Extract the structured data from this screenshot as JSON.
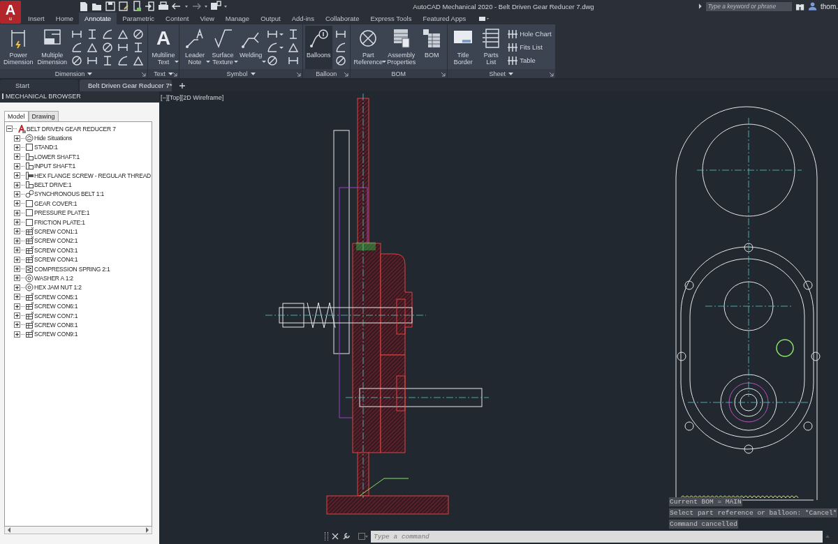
{
  "app_button": {
    "letter": "A",
    "badge": "u"
  },
  "title": "AutoCAD Mechanical 2020 - Belt Driven Gear Reducer 7.dwg",
  "search": {
    "placeholder": "Type a keyword or phrase"
  },
  "user": {
    "name": "thom."
  },
  "ribbon_tabs": [
    {
      "label": "Insert",
      "selected": false
    },
    {
      "label": "Home",
      "selected": false
    },
    {
      "label": "Annotate",
      "selected": true
    },
    {
      "label": "Parametric",
      "selected": false
    },
    {
      "label": "Content",
      "selected": false
    },
    {
      "label": "View",
      "selected": false
    },
    {
      "label": "Manage",
      "selected": false
    },
    {
      "label": "Output",
      "selected": false
    },
    {
      "label": "Add-ins",
      "selected": false
    },
    {
      "label": "Collaborate",
      "selected": false
    },
    {
      "label": "Express Tools",
      "selected": false
    },
    {
      "label": "Featured Apps",
      "selected": false
    }
  ],
  "ribbon_panels": [
    {
      "title": "Dimension",
      "has_menu": true,
      "items": [
        {
          "kind": "large",
          "label": "Power\nDimension",
          "has_menu": false,
          "hovered": false
        },
        {
          "kind": "large",
          "label": "Multiple\nDimension",
          "has_menu": false,
          "hovered": false
        },
        {
          "kind": "small",
          "has_menu": false,
          "hovered": false
        },
        {
          "kind": "small",
          "has_menu": false,
          "hovered": false
        },
        {
          "kind": "small",
          "has_menu": false,
          "hovered": false
        },
        {
          "kind": "small",
          "has_menu": false,
          "hovered": false
        },
        {
          "kind": "small",
          "has_menu": false,
          "hovered": false
        },
        {
          "kind": "small",
          "has_menu": false,
          "hovered": false
        },
        {
          "kind": "small",
          "has_menu": false,
          "hovered": false
        },
        {
          "kind": "small",
          "has_menu": false,
          "hovered": false
        },
        {
          "kind": "small",
          "has_menu": false,
          "hovered": false
        },
        {
          "kind": "small",
          "has_menu": false,
          "hovered": false
        },
        {
          "kind": "small",
          "has_menu": false,
          "hovered": false
        },
        {
          "kind": "small",
          "has_menu": false,
          "hovered": false
        },
        {
          "kind": "small",
          "has_menu": false,
          "hovered": false
        },
        {
          "kind": "small",
          "has_menu": false,
          "hovered": false
        },
        {
          "kind": "small",
          "has_menu": false,
          "hovered": false
        }
      ]
    },
    {
      "title": "Text",
      "has_menu": true,
      "items": [
        {
          "kind": "large",
          "label": "Multiline\nText",
          "glyph": "A",
          "has_menu": true,
          "hovered": false
        }
      ]
    },
    {
      "title": "Symbol",
      "has_menu": true,
      "items": [
        {
          "kind": "large",
          "label": "Leader\nNote",
          "has_menu": true,
          "hovered": false
        },
        {
          "kind": "large",
          "label": "Surface\nTexture",
          "has_menu": true,
          "hovered": false
        },
        {
          "kind": "large",
          "label": "Welding",
          "has_menu": true,
          "hovered": false
        },
        {
          "kind": "small",
          "has_menu": true,
          "hovered": false
        },
        {
          "kind": "small",
          "has_menu": true,
          "hovered": false
        },
        {
          "kind": "small",
          "has_menu": false,
          "hovered": false
        },
        {
          "kind": "small",
          "has_menu": false,
          "hovered": false
        },
        {
          "kind": "small",
          "has_menu": false,
          "hovered": false
        },
        {
          "kind": "small",
          "has_menu": false,
          "hovered": false
        }
      ]
    },
    {
      "title": "Balloon",
      "has_menu": false,
      "items": [
        {
          "kind": "large",
          "label": "Balloons",
          "has_menu": false,
          "hovered": true
        },
        {
          "kind": "small",
          "has_menu": false,
          "hovered": false
        },
        {
          "kind": "small",
          "has_menu": false,
          "hovered": false
        },
        {
          "kind": "small",
          "has_menu": false,
          "hovered": false
        }
      ]
    },
    {
      "title": "BOM",
      "has_menu": false,
      "items": [
        {
          "kind": "large",
          "label": "Part\nReference",
          "has_menu": true,
          "hovered": false
        },
        {
          "kind": "large",
          "label": "Assembly\nProperties",
          "has_menu": false,
          "hovered": false
        },
        {
          "kind": "large",
          "label": "BOM",
          "has_menu": false,
          "hovered": false
        }
      ]
    },
    {
      "title": "Sheet",
      "has_menu": true,
      "items": [
        {
          "kind": "large",
          "label": "Title\nBorder",
          "has_menu": false,
          "hovered": false
        },
        {
          "kind": "large",
          "label": "Parts\nList",
          "has_menu": false,
          "hovered": false
        },
        {
          "kind": "small_label",
          "label": "Hole Chart",
          "has_menu": false,
          "hovered": false
        },
        {
          "kind": "small_label",
          "label": "Fits List",
          "has_menu": false,
          "hovered": false
        },
        {
          "kind": "small_label",
          "label": "Table",
          "has_menu": false,
          "hovered": false
        }
      ]
    }
  ],
  "document_tabs": [
    {
      "label": "Start",
      "selected": false
    },
    {
      "label": "Belt Driven Gear Reducer 7*",
      "selected": true
    }
  ],
  "browser": {
    "title": "MECHANICAL BROWSER",
    "tabs": [
      {
        "label": "Model",
        "selected": true
      },
      {
        "label": "Drawing",
        "selected": false
      }
    ],
    "tree": [
      {
        "label": "BELT DRIVEN GEAR REDUCER 7",
        "kind": "assembly",
        "expanded": true,
        "children": [
          {
            "label": "Hide Situations",
            "kind": "situations",
            "expanded": false
          },
          {
            "label": "STAND:1",
            "kind": "part",
            "expanded": false
          },
          {
            "label": "LOWER SHAFT:1",
            "kind": "shaft",
            "expanded": false
          },
          {
            "label": "INPUT SHAFT:1",
            "kind": "shaft",
            "expanded": false
          },
          {
            "label": "HEX FLANGE SCREW - REGULAR THREAD",
            "kind": "bolt",
            "expanded": false
          },
          {
            "label": "BELT DRIVE:1",
            "kind": "shaft",
            "expanded": false
          },
          {
            "label": "SYNCHRONOUS BELT 1:1",
            "kind": "belt",
            "expanded": false
          },
          {
            "label": "GEAR COVER:1",
            "kind": "part",
            "expanded": false
          },
          {
            "label": "PRESSURE PLATE:1",
            "kind": "part",
            "expanded": false
          },
          {
            "label": "FRICTION PLATE:1",
            "kind": "part",
            "expanded": false
          },
          {
            "label": "SCREW CON1:1",
            "kind": "screw",
            "expanded": false
          },
          {
            "label": "SCREW CON2:1",
            "kind": "screw",
            "expanded": false
          },
          {
            "label": "SCREW CON3:1",
            "kind": "screw",
            "expanded": false
          },
          {
            "label": "SCREW CON4:1",
            "kind": "screw",
            "expanded": false
          },
          {
            "label": "COMPRESSION SPRING 2:1",
            "kind": "spring",
            "expanded": false
          },
          {
            "label": "WASHER A 1:2",
            "kind": "washer",
            "expanded": false
          },
          {
            "label": "HEX JAM NUT 1:2",
            "kind": "washer",
            "expanded": false
          },
          {
            "label": "SCREW CON5:1",
            "kind": "screw",
            "expanded": false
          },
          {
            "label": "SCREW CON6:1",
            "kind": "screw",
            "expanded": false
          },
          {
            "label": "SCREW CON7:1",
            "kind": "screw",
            "expanded": false
          },
          {
            "label": "SCREW CON8:1",
            "kind": "screw",
            "expanded": false
          },
          {
            "label": "SCREW CON9:1",
            "kind": "screw",
            "expanded": false
          }
        ]
      }
    ]
  },
  "viewport": {
    "label": "[−][Top][2D Wireframe]"
  },
  "command_history": [
    "Current BOM = MAIN",
    "Select part reference or balloon: *Cancel*",
    "Command cancelled"
  ],
  "command_line": {
    "placeholder": "Type a command"
  }
}
